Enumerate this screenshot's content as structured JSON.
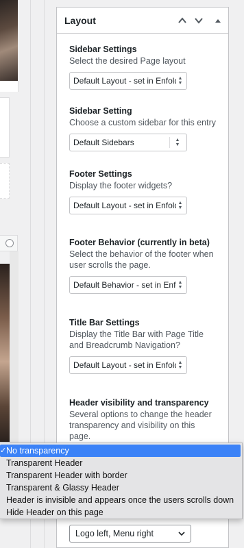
{
  "metabox": {
    "title": "Layout"
  },
  "sections": [
    {
      "title": "Sidebar Settings",
      "description": "Select the desired Page layout",
      "value": "Default Layout - set in Enfold"
    },
    {
      "title": "Sidebar Setting",
      "description": "Choose a custom sidebar for this entry",
      "value": "Default Sidebars"
    },
    {
      "title": "Footer Settings",
      "description": "Display the footer widgets?",
      "value": "Default Layout - set in Enfold"
    },
    {
      "title": "Footer Behavior (currently in beta)",
      "description": "Select the behavior of the footer when user scrolls the page.",
      "value": "Default Behavior - set in Enfold"
    },
    {
      "title": "Title Bar Settings",
      "description": "Display the Title Bar with Page Title and Breadcrumb Navigation?",
      "value": "Default Layout - set in Enfold"
    },
    {
      "title": "Header visibility and transparency",
      "description": "Several options to change the header transparency and visibility on this page."
    }
  ],
  "dropdown": {
    "options": [
      "No transparency",
      "Transparent Header",
      "Transparent Header with border",
      "Transparent & Glassy Header",
      "Header is invisible and appears once the users scrolls down",
      "Hide Header on this page"
    ],
    "selected_index": 0
  },
  "header_layout_select": {
    "value": "Logo left, Menu right"
  },
  "colors": {
    "accent": "#3b82f7",
    "panel_border": "#c3c4c7",
    "background": "#f0f0f1"
  }
}
